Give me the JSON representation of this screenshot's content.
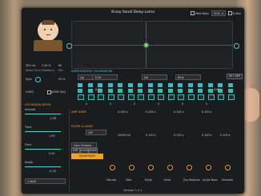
{
  "header": {
    "title": "Krazy Sandi Delay-Lama",
    "midi_keys_label": "Midi Keys",
    "rate_value": "90%",
    "bank_label": "A Key"
  },
  "voice": {
    "vals": [
      "350 ms",
      "2.00 %",
      "80",
      "25 %"
    ],
    "labels": [
      "Noise Time",
      "Feedback",
      "Mix"
    ],
    "sync_label": "Sync",
    "adsr_label": "ADSR Only",
    "adsr_val": "0.890"
  },
  "arp": {
    "title": "ARPEGGIATOR / SEQUENCER",
    "mode_value": "Up",
    "rate_value": "1/16",
    "steps_value": "No",
    "pitch_value": "Bins",
    "set_button": "SET ARP",
    "row1_vals": [
      "0.50",
      "0.80"
    ],
    "row2_vals": [
      "0",
      "0",
      "0",
      "0",
      "0",
      "0"
    ]
  },
  "lfo": {
    "title": "LFO MODULATION",
    "labels": [
      "Amount",
      "Time",
      "Form",
      "Depth"
    ],
    "values": [
      "-1.98",
      "1.00",
      "0.00",
      "-0.18"
    ],
    "dest_value": "Cutoff"
  },
  "amp": {
    "title": "AMP ADSR",
    "vals": [
      "0.100 s",
      "0.100 s",
      "0.100 s",
      "0.100 s"
    ]
  },
  "filter": {
    "title": "FILTER & ADSR",
    "type_value": "Off",
    "cutoff_val": "20000 Hz",
    "vals": [
      "0.100 s",
      "0.100 s",
      "0.100 s",
      "0.100 s",
      "0.100 s"
    ],
    "user_presets": "User Presets",
    "preset_buttons": [
      "INIT",
      "LOAD",
      "SAVE"
    ],
    "randomize": "RANDOMIZE"
  },
  "bottom_labels": [
    "Vibrato",
    "Vibe",
    "Pulse",
    "Heat",
    "Dry Balance",
    "Audio Boss",
    "Kirkdale"
  ],
  "footer": {
    "version": "Version 1.0.1"
  }
}
